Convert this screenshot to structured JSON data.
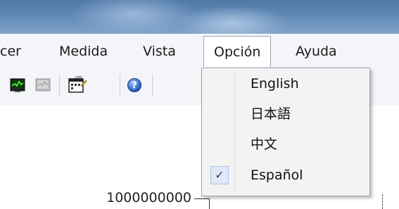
{
  "menubar": {
    "items": [
      {
        "label": "cer"
      },
      {
        "label": "Medida"
      },
      {
        "label": "Vista"
      },
      {
        "label": "Opción"
      },
      {
        "label": "Ayuda"
      }
    ]
  },
  "options_menu": {
    "items": [
      {
        "label": "English",
        "checked": false
      },
      {
        "label": "日本語",
        "checked": false
      },
      {
        "label": "中文",
        "checked": false
      },
      {
        "label": "Español",
        "checked": true
      }
    ],
    "check_glyph": "✓"
  },
  "toolbar": {
    "icons": [
      "monitor-graph-icon",
      "monitor-graph-disabled-icon",
      "calendar-edit-icon",
      "help-icon"
    ]
  },
  "chart": {
    "y_tick_label": "1000000000"
  }
}
